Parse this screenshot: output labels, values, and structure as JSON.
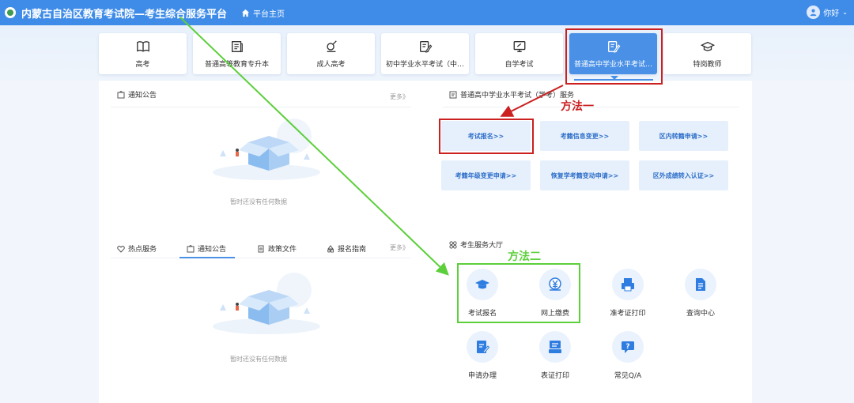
{
  "header": {
    "site_title": "内蒙古自治区教育考试院—考生综合服务平台",
    "home_label": "平台主页",
    "user_greeting": "你好",
    "color": "#3f8ce8"
  },
  "categories": [
    {
      "label": "高考",
      "icon": "book-open-icon"
    },
    {
      "label": "普通高等教育专升本",
      "icon": "document-icon"
    },
    {
      "label": "成人高考",
      "icon": "pen-certificate-icon"
    },
    {
      "label": "初中学业水平考试（中…",
      "icon": "edit-document-icon"
    },
    {
      "label": "自学考试",
      "icon": "monitor-edit-icon"
    },
    {
      "label": "普通高中学业水平考试…",
      "icon": "edit-document-icon",
      "active": true
    },
    {
      "label": "特岗教师",
      "icon": "graduation-cap-icon"
    }
  ],
  "notice_section": {
    "title": "通知公告",
    "more": "更多》",
    "empty_text": "暂时还没有任何数据"
  },
  "exam_service": {
    "title": "普通高中学业水平考试（学考）服务",
    "buttons": [
      "考试报名>>",
      "考籍信息变更>>",
      "区内转籍申请>>",
      "考籍年级变更申请>>",
      "恢复学考籍变动申请>>",
      "区外成绩转入认证>>"
    ]
  },
  "tabs": {
    "items": [
      "热点服务",
      "通知公告",
      "政策文件",
      "报名指南"
    ],
    "active_index": 1,
    "more": "更多》",
    "empty_text": "暂时还没有任何数据"
  },
  "hall": {
    "title": "考生服务大厅",
    "items": [
      {
        "label": "考试报名",
        "icon": "mortarboard-icon"
      },
      {
        "label": "网上缴费",
        "icon": "yen-coin-icon"
      },
      {
        "label": "准考证打印",
        "icon": "printer-icon"
      },
      {
        "label": "查询中心",
        "icon": "search-document-icon"
      },
      {
        "label": "申请办理",
        "icon": "edit-form-icon"
      },
      {
        "label": "表证打印",
        "icon": "form-print-icon"
      },
      {
        "label": "常见Q/A",
        "icon": "qa-chat-icon"
      }
    ]
  },
  "annotations": {
    "method_one": "方法一",
    "method_two": "方法二",
    "red": "#cc1f1f",
    "green": "#5ccf3b"
  }
}
